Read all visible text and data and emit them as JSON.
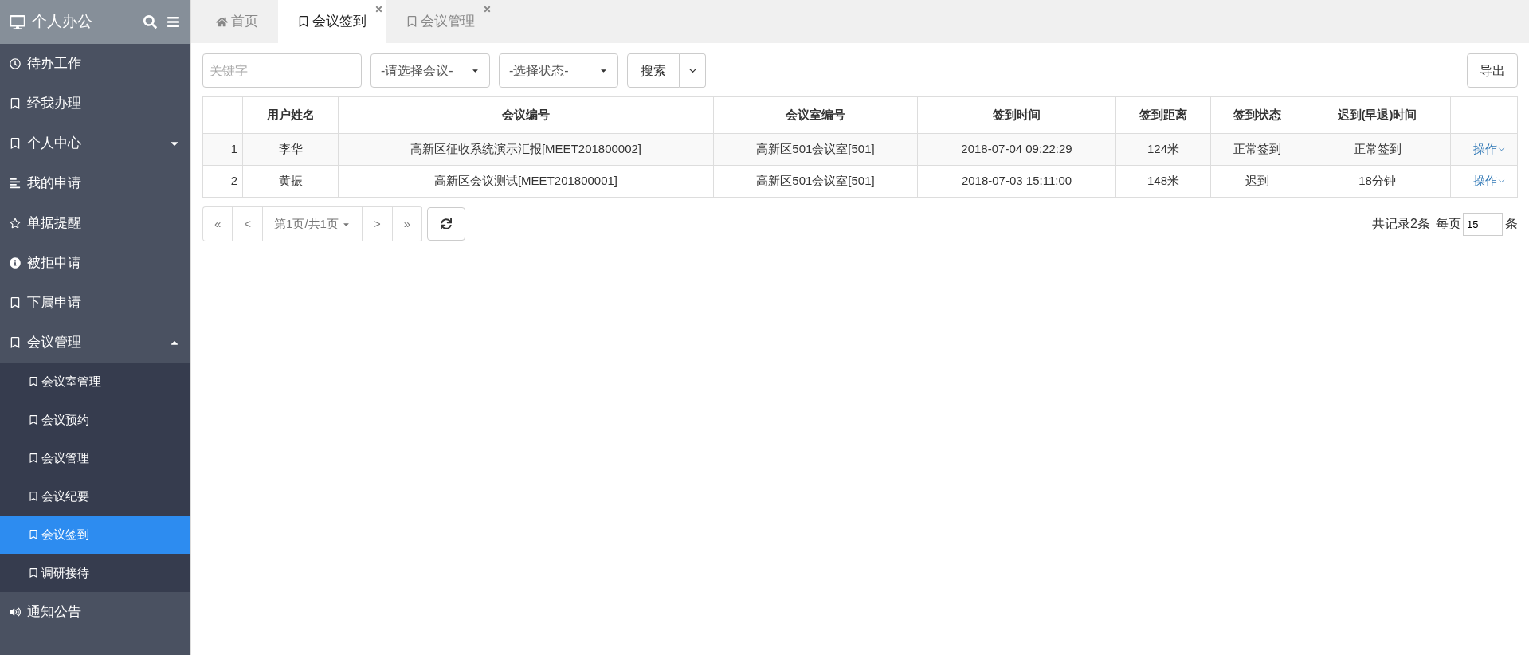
{
  "sidebar": {
    "title": "个人办公",
    "items": [
      {
        "label": "待办工作"
      },
      {
        "label": "经我办理"
      },
      {
        "label": "个人中心",
        "expanded": false
      },
      {
        "label": "我的申请"
      },
      {
        "label": "单据提醒"
      },
      {
        "label": "被拒申请"
      },
      {
        "label": "下属申请"
      },
      {
        "label": "会议管理",
        "expanded": true,
        "children": [
          {
            "label": "会议室管理",
            "selected": false
          },
          {
            "label": "会议预约",
            "selected": false
          },
          {
            "label": "会议管理",
            "selected": false
          },
          {
            "label": "会议纪要",
            "selected": false
          },
          {
            "label": "会议签到",
            "selected": true
          },
          {
            "label": "调研接待",
            "selected": false
          }
        ]
      },
      {
        "label": "通知公告"
      }
    ]
  },
  "tabs": [
    {
      "label": "首页",
      "selected": false,
      "closable": false
    },
    {
      "label": "会议签到",
      "selected": true,
      "closable": true
    },
    {
      "label": "会议管理",
      "selected": false,
      "closable": true
    }
  ],
  "filters": {
    "keyword": {
      "placeholder": "关键字"
    },
    "meeting_select": "-请选择会议-",
    "status_select": "-选择状态-",
    "search_button": "搜索",
    "export_button": "导出"
  },
  "table": {
    "columns": [
      "用户姓名",
      "会议编号",
      "会议室编号",
      "签到时间",
      "签到距离",
      "签到状态",
      "迟到(早退)时间"
    ],
    "rows": [
      {
        "index": "1",
        "cells": [
          "李华",
          "高新区征收系统演示汇报[MEET201800002]",
          "高新区501会议室[501]",
          "2018-07-04 09:22:29",
          "124米",
          "正常签到",
          "正常签到"
        ],
        "action": "操作"
      },
      {
        "index": "2",
        "cells": [
          "黄振",
          "高新区会议测试[MEET201800001]",
          "高新区501会议室[501]",
          "2018-07-03 15:11:00",
          "148米",
          "迟到",
          "18分钟"
        ],
        "action": "操作"
      }
    ]
  },
  "pagination": {
    "first": "«",
    "prev": "<",
    "page": "第1页/共1页",
    "next": ">",
    "last": "»",
    "total": "共记录2条",
    "per_page_label": "每页",
    "per_page": "15",
    "unit": "条"
  }
}
